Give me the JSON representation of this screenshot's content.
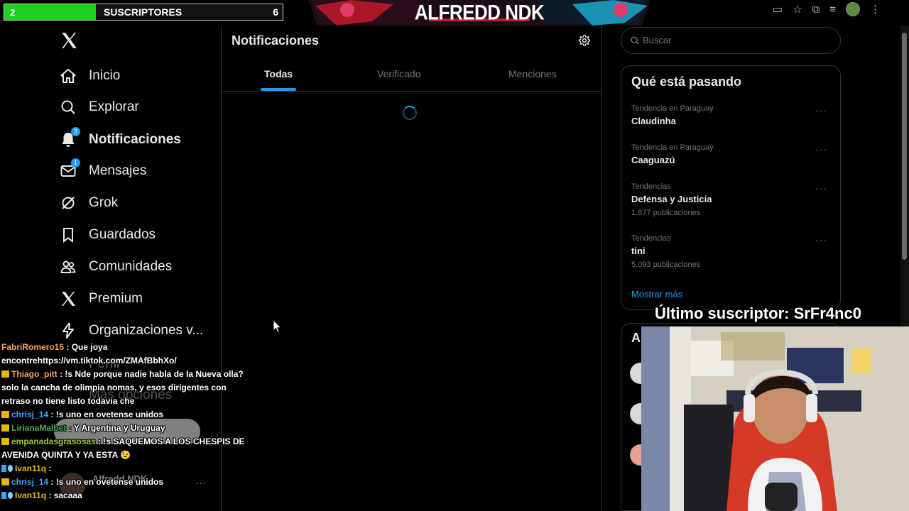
{
  "overlay": {
    "sub_goal": {
      "current": "2",
      "label": "SUSCRIPTORES",
      "target": "6",
      "progress": 0.33
    },
    "banner_title": "ALFREDD NDK",
    "last_subscriber": "Último suscriptor: SrFr4nc0"
  },
  "sidebar": {
    "items": [
      {
        "label": "Inicio",
        "icon": "home-icon"
      },
      {
        "label": "Explorar",
        "icon": "search-icon"
      },
      {
        "label": "Notificaciones",
        "icon": "bell-icon",
        "badge": "3",
        "active": true
      },
      {
        "label": "Mensajes",
        "icon": "envelope-icon",
        "badge": "1"
      },
      {
        "label": "Grok",
        "icon": "grok-icon"
      },
      {
        "label": "Guardados",
        "icon": "bookmark-icon"
      },
      {
        "label": "Comunidades",
        "icon": "people-icon"
      },
      {
        "label": "Premium",
        "icon": "x-logo-icon"
      },
      {
        "label": "Organizaciones v...",
        "icon": "lightning-icon"
      }
    ],
    "hidden": {
      "perfil": "Perfil",
      "more": "Más opciones",
      "account_name": "Alfredd NDK"
    }
  },
  "main": {
    "title": "Notificaciones",
    "tabs": [
      {
        "label": "Todas",
        "active": true
      },
      {
        "label": "Verificado"
      },
      {
        "label": "Menciones"
      }
    ]
  },
  "right": {
    "search_placeholder": "Buscar",
    "trends_title": "Qué está pasando",
    "trends": [
      {
        "context": "Tendencia en Paraguay",
        "name": "Claudinha",
        "count": ""
      },
      {
        "context": "Tendencia en Paraguay",
        "name": "Caaguazú",
        "count": ""
      },
      {
        "context": "Tendencias",
        "name": "Defensa y Justicia",
        "count": "1.877 publicaciones"
      },
      {
        "context": "Tendencias",
        "name": "tini",
        "count": "5.093 publicaciones"
      }
    ],
    "show_more": "Mostrar más",
    "follow_title_initial": "A"
  },
  "chat": [
    {
      "user": "FabriRomero15",
      "color": "#f4a460",
      "text": " : Que joya encontrehttps://vm.tiktok.com/ZMAfBbhXo/",
      "badge": ""
    },
    {
      "user": "Thiago_pitt",
      "color": "#f4a460",
      "text": " : !s Nde porque nadie habla de la Nueva olla? solo la cancha de olimpia nomas, y esos dirigentes con retraso no tiene listo todavia che",
      "badge": "crown"
    },
    {
      "user": "chrisj_14",
      "color": "#3ea6ff",
      "text": " : !s uno en ovetense unidos",
      "badge": "crown"
    },
    {
      "user": "LirianaMalbet",
      "color": "#4caf50",
      "text": " : Y Argentina y Uruguay",
      "badge": "crown"
    },
    {
      "user": "empanadasgrasosas",
      "color": "#9acd32",
      "text": " : !s SAQUEMOS A LOS CHESPIS DE AVENIDA QUINTA Y YA ESTA 😉",
      "badge": "crown"
    },
    {
      "user": "Ivan11q",
      "color": "#e6b800",
      "text": " :",
      "badge": "mod"
    },
    {
      "user": "chrisj_14",
      "color": "#3ea6ff",
      "text": " : !s uno en ovetense unidos",
      "badge": "crown"
    },
    {
      "user": "Ivan11q",
      "color": "#e6b800",
      "text": " : sacaaa",
      "badge": "mod"
    }
  ]
}
